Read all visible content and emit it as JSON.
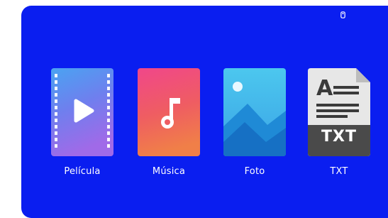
{
  "colors": {
    "background": "#0a1ef0",
    "label": "#ffffff"
  },
  "status": {
    "icon": "usb-drive-icon"
  },
  "media_apps": [
    {
      "label": "Película",
      "icon": "film-play-icon"
    },
    {
      "label": "Música",
      "icon": "music-note-icon"
    },
    {
      "label": "Foto",
      "icon": "photo-mountains-icon"
    },
    {
      "label": "TXT",
      "icon": "txt-document-icon"
    }
  ]
}
